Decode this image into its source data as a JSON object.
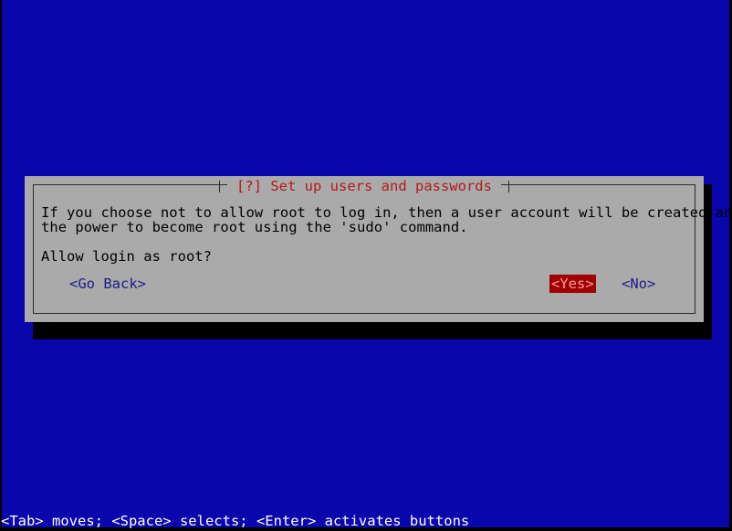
{
  "screen": {
    "background_color": "#0a06ad",
    "bezel_color": "#000000"
  },
  "dialog": {
    "title": "[?] Set up users and passwords",
    "title_color": "#b21a1a",
    "background_color": "#aaaaaa",
    "border_color": "#2b2b2b",
    "shadow_color": "#000000",
    "body": {
      "paragraph1_line1": "If you choose not to allow root to log in, then a user account will be created and given",
      "paragraph1_line2": "the power to become root using the 'sudo' command.",
      "paragraph2_line1": "Allow login as root?"
    },
    "buttons": [
      {
        "label": "<Go Back>",
        "name": "go-back",
        "selected": false,
        "text_color": "#1b1b8c"
      },
      {
        "label": "<Yes>",
        "name": "yes",
        "selected": true,
        "text_color": "#ff9a9a",
        "highlight_color": "#a00000"
      },
      {
        "label": "<No>",
        "name": "no",
        "selected": false,
        "text_color": "#1b1b8c"
      }
    ]
  },
  "status_bar": {
    "text": "<Tab> moves; <Space> selects; <Enter> activates buttons",
    "text_color": "#ffffff",
    "background_color": "#0a06ad"
  }
}
